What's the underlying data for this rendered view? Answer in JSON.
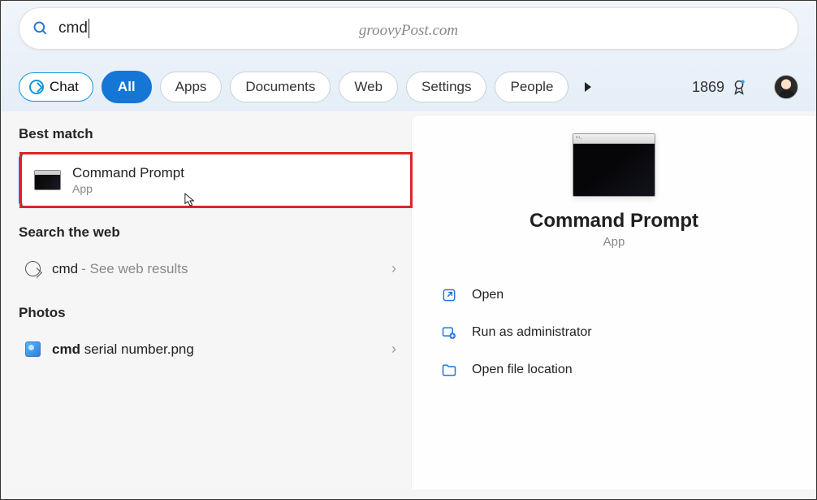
{
  "watermark": "groovyPost.com",
  "search": {
    "value": "cmd"
  },
  "filters": {
    "chat": "Chat",
    "all": "All",
    "apps": "Apps",
    "documents": "Documents",
    "web": "Web",
    "settings": "Settings",
    "people": "People"
  },
  "rewards": {
    "points": "1869"
  },
  "sections": {
    "best_match": "Best match",
    "search_web": "Search the web",
    "photos": "Photos"
  },
  "result": {
    "title": "Command Prompt",
    "subtitle": "App"
  },
  "web_result": {
    "query": "cmd",
    "hint": "- See web results"
  },
  "photo_result": {
    "bold": "cmd",
    "rest": " serial number.png"
  },
  "detail": {
    "title": "Command Prompt",
    "subtitle": "App",
    "actions": {
      "open": "Open",
      "admin": "Run as administrator",
      "location": "Open file location"
    }
  }
}
